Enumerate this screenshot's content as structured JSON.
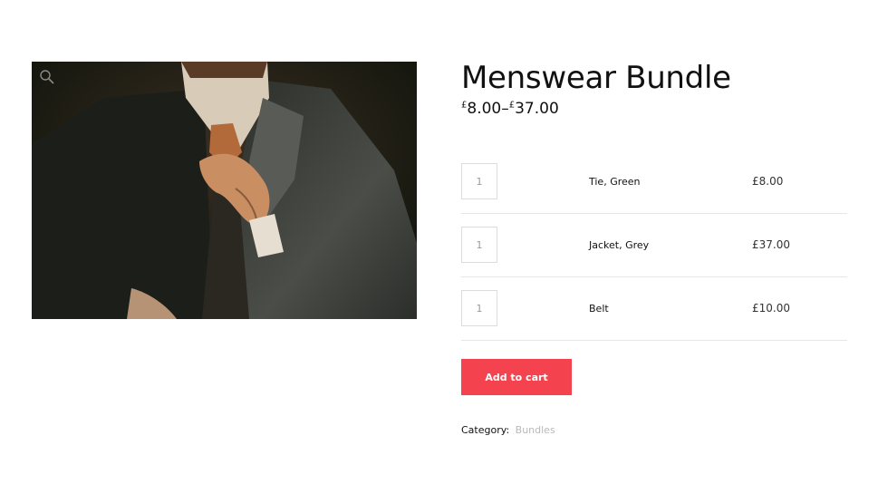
{
  "product": {
    "title": "Menswear Bundle",
    "price_currency": "£",
    "price_min": "8.00",
    "price_sep": "–",
    "price_max": "37.00"
  },
  "gallery": {
    "image": "man-in-suit-adjusting-tie-photo",
    "zoom_icon": "magnifier-icon"
  },
  "bundle_items": [
    {
      "qty": "1",
      "name": "Tie, Green",
      "price": "£8.00"
    },
    {
      "qty": "1",
      "name": "Jacket, Grey",
      "price": "£37.00"
    },
    {
      "qty": "1",
      "name": "Belt",
      "price": "£10.00"
    }
  ],
  "cart": {
    "add_label": "Add to cart"
  },
  "meta": {
    "category_label": "Category:",
    "category_value": "Bundles"
  },
  "colors": {
    "accent": "#f5424f",
    "link": "#b9b9b9",
    "divider": "#e6e6e6"
  }
}
